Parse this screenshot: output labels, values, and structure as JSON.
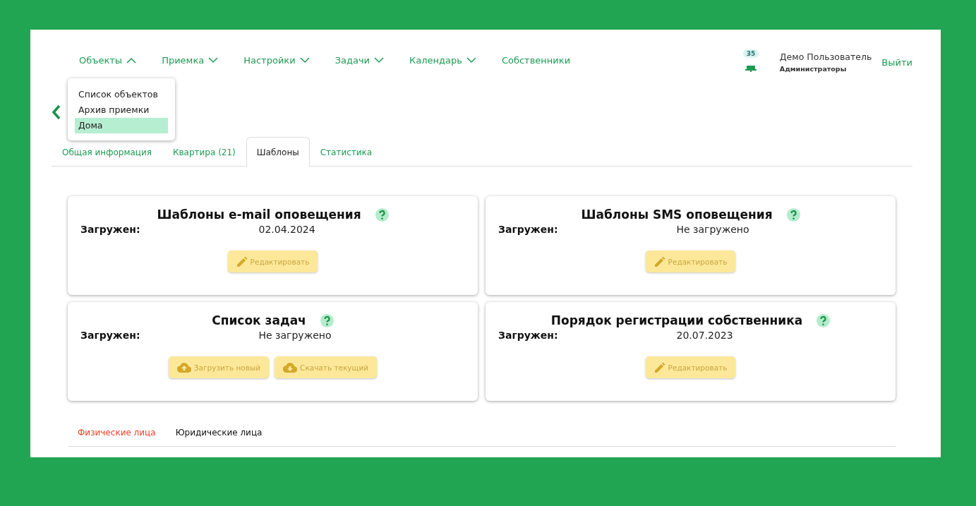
{
  "nav": [
    {
      "label": "Объекты",
      "kind": "dropdown",
      "expanded": true
    },
    {
      "label": "Приемка",
      "kind": "dropdown",
      "expanded": false
    },
    {
      "label": "Настройки",
      "kind": "dropdown",
      "expanded": false
    },
    {
      "label": "Задачи",
      "kind": "dropdown",
      "expanded": false
    },
    {
      "label": "Календарь",
      "kind": "dropdown",
      "expanded": false
    },
    {
      "label": "Собственники",
      "kind": "link"
    }
  ],
  "dropdown": [
    {
      "label": "Список объектов",
      "selected": false
    },
    {
      "label": "Архив приемки",
      "selected": false
    },
    {
      "label": "Дома",
      "selected": true
    }
  ],
  "notifications": {
    "count": "35"
  },
  "user": {
    "name": "Демо Пользователь",
    "role": "Администраторы",
    "logout": "Выйти"
  },
  "tabs": [
    {
      "label": "Общая информация",
      "selected": false
    },
    {
      "label": "Квартира (21)",
      "selected": false
    },
    {
      "label": "Шаблоны",
      "selected": true
    },
    {
      "label": "Статистика",
      "selected": false
    }
  ],
  "cards": [
    {
      "title": "Шаблоны e-mail оповещения",
      "label": "Загружен:",
      "value": "02.04.2024",
      "buttons": [
        {
          "kind": "edit",
          "label": "Редактировать"
        }
      ]
    },
    {
      "title": "Шаблоны SMS оповещения",
      "label": "Загружен:",
      "value": "Не загружено",
      "buttons": [
        {
          "kind": "edit",
          "label": "Редактировать"
        }
      ]
    },
    {
      "title": "Список задач",
      "label": "Загружен:",
      "value": "Не загружено",
      "buttons": [
        {
          "kind": "upload",
          "label": "Загрузить новый"
        },
        {
          "kind": "download",
          "label": "Скачать текущий"
        }
      ]
    },
    {
      "title": "Порядок регистрации собственника",
      "label": "Загружен:",
      "value": "20.07.2023",
      "buttons": [
        {
          "kind": "edit",
          "label": "Редактировать"
        }
      ]
    }
  ],
  "subtabs": [
    {
      "label": "Физические лица",
      "selected": true
    },
    {
      "label": "Юридические лица",
      "selected": false
    }
  ]
}
